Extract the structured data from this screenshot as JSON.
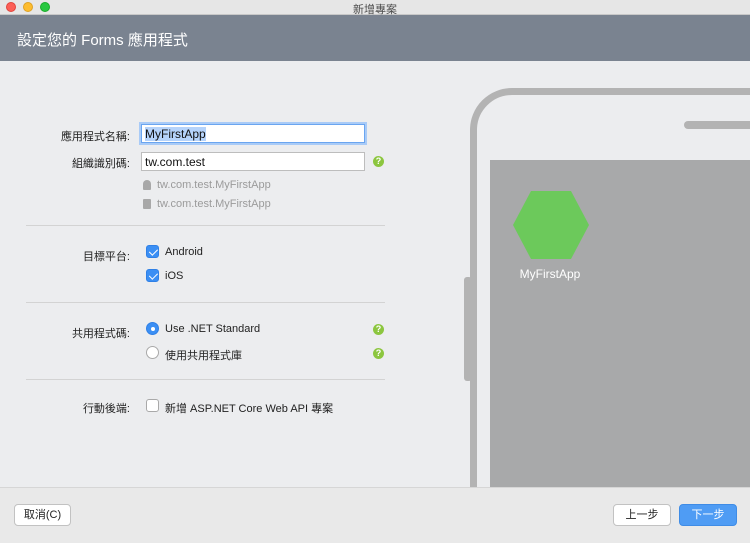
{
  "window": {
    "title": "新增專案"
  },
  "header": {
    "title": "設定您的 Forms 應用程式"
  },
  "form": {
    "app_name_label": "應用程式名稱:",
    "app_name_value": "MyFirstApp",
    "org_id_label": "組織識別碼:",
    "org_id_value": "tw.com.test",
    "android_bundle": "tw.com.test.MyFirstApp",
    "ios_bundle": "tw.com.test.MyFirstApp",
    "target_platform_label": "目標平台:",
    "platforms": [
      {
        "label": "Android",
        "checked": true
      },
      {
        "label": "iOS",
        "checked": true
      }
    ],
    "shared_code_label": "共用程式碼:",
    "shared_options": [
      {
        "label": "Use .NET Standard",
        "selected": true
      },
      {
        "label": "使用共用程式庫",
        "selected": false
      }
    ],
    "backend_label": "行動後端:",
    "backend_option": {
      "label": "新增 ASP.NET Core Web API 專案",
      "checked": false
    },
    "help_glyph": "?"
  },
  "preview": {
    "app_name": "MyFirstApp",
    "icon_color": "#6cc95b"
  },
  "footer": {
    "cancel_label": "取消(C)",
    "back_label": "上一步",
    "next_label": "下一步"
  },
  "colors": {
    "accent": "#3b8ff4",
    "header_bg": "#7a8390",
    "help": "#8cc63f"
  }
}
